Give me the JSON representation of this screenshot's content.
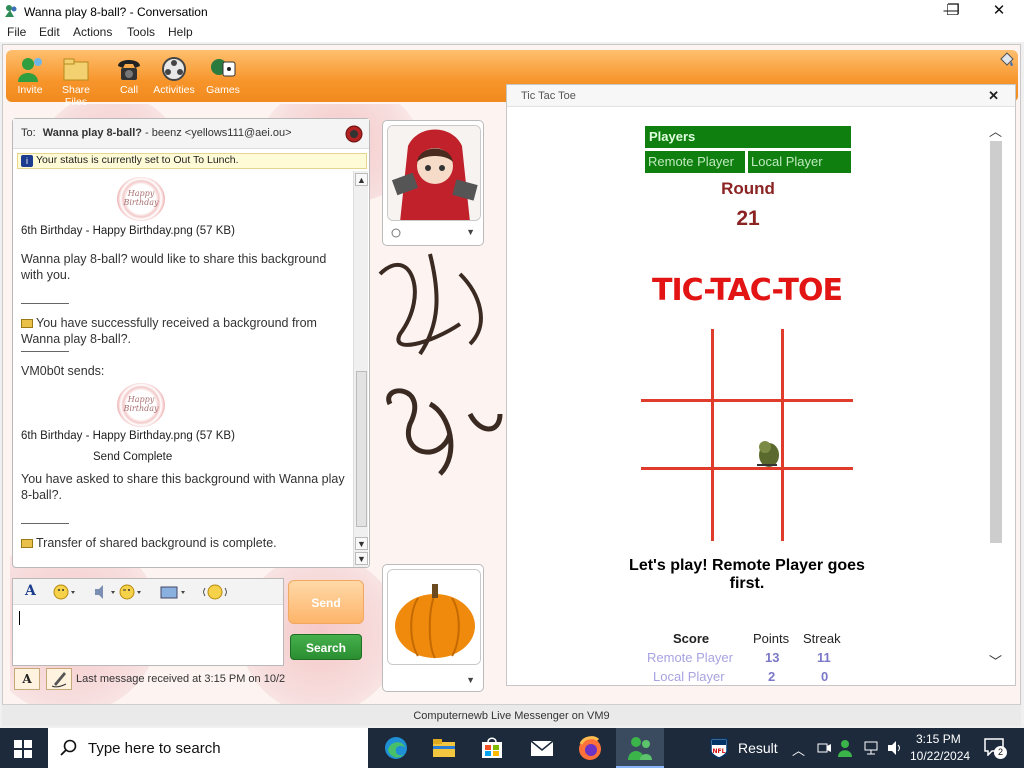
{
  "window": {
    "title": "Wanna play 8-ball? - Conversation",
    "minimize": "—",
    "maximize": "❐",
    "close": "✕"
  },
  "menu": [
    "File",
    "Edit",
    "Actions",
    "Tools",
    "Help"
  ],
  "toolbar": {
    "items": [
      {
        "label": "Invite",
        "icon": "invite-icon"
      },
      {
        "label": "Share Files",
        "icon": "share-files-icon"
      },
      {
        "label": "Call",
        "icon": "phone-icon"
      },
      {
        "label": "Activities",
        "icon": "activities-icon"
      },
      {
        "label": "Games",
        "icon": "games-icon"
      }
    ]
  },
  "conversation": {
    "to_label": "To:",
    "to_name": "Wanna play 8-ball?",
    "to_sep": " - beenz <yellows111@aei.ou>",
    "status_text": "Your status is currently set to Out To Lunch.",
    "thumb_text": "Happy Birthday",
    "file1": "6th Birthday - Happy Birthday.png (57 KB)",
    "share_request": "Wanna play 8-ball? would like to share this background with you.",
    "received": "You have successfully received a background from Wanna play 8-ball?.",
    "sender": "VM0b0t sends:",
    "file2": "6th Birthday - Happy Birthday.png (57 KB)",
    "send_complete": "Send Complete",
    "asked_share": "You have asked to share this background with Wanna play 8-ball?.",
    "transfer_complete": "Transfer of shared background is complete."
  },
  "compose": {
    "send_label": "Send",
    "search_label": "Search",
    "last_message": "Last message received at 3:15 PM on 10/2"
  },
  "game": {
    "window_title": "Tic Tac Toe",
    "players_label": "Players",
    "remote_player": "Remote Player",
    "local_player": "Local Player",
    "round_label": "Round",
    "round_number": "21",
    "logo": "TIC-TAC-TOE",
    "message": "Let's play! Remote Player goes first.",
    "score_header": "Score",
    "points_header": "Points",
    "streak_header": "Streak",
    "remote_points": "13",
    "remote_streak": "11",
    "local_points": "2",
    "local_streak": "0"
  },
  "status_strip": "Computernewb Live Messenger on VM9",
  "taskbar": {
    "search_placeholder": "Type here to search",
    "result_label": "Result",
    "time": "3:15 PM",
    "date": "10/22/2024",
    "notifications": "2"
  },
  "colors": {
    "toolbar_orange": "#f7952b",
    "game_green": "#0f7f0f",
    "round_red": "#8b2323",
    "grid_red": "#e03c2c",
    "taskbar": "#1c2a3b"
  }
}
